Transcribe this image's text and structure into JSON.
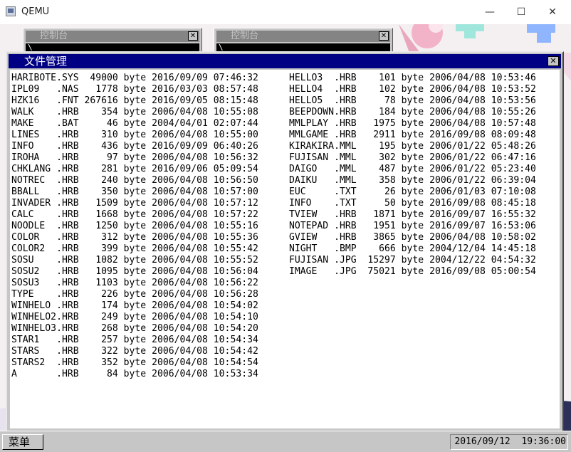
{
  "host_window": {
    "title": "QEMU",
    "minimize": "—",
    "maximize": "☐",
    "close": "✕"
  },
  "consoles": [
    {
      "title": "控制台",
      "close": "✕",
      "cursor": "\\"
    },
    {
      "title": "控制台",
      "close": "✕",
      "cursor": "\\"
    }
  ],
  "file_manager": {
    "title": "文件管理",
    "close": "✕",
    "columns": [
      [
        "HARIBOTE.SYS  49000 byte 2016/09/09 07:46:32",
        "IPL09   .NAS   1778 byte 2016/03/03 08:57:48",
        "HZK16   .FNT 267616 byte 2016/09/05 08:15:48",
        "WALK    .HRB    354 byte 2006/04/08 10:55:08",
        "MAKE    .BAT     46 byte 2004/04/01 02:07:44",
        "LINES   .HRB    310 byte 2006/04/08 10:55:00",
        "INFO    .HRB    436 byte 2016/09/09 06:40:26",
        "IROHA   .HRB     97 byte 2006/04/08 10:56:32",
        "CHKLANG .HRB    281 byte 2016/09/06 05:09:54",
        "NOTREC  .HRB    240 byte 2006/04/08 10:56:50",
        "BBALL   .HRB    350 byte 2006/04/08 10:57:00",
        "INVADER .HRB   1509 byte 2006/04/08 10:57:12",
        "CALC    .HRB   1668 byte 2006/04/08 10:57:22",
        "NOODLE  .HRB   1250 byte 2006/04/08 10:55:16",
        "COLOR   .HRB    312 byte 2006/04/08 10:55:36",
        "COLOR2  .HRB    399 byte 2006/04/08 10:55:42",
        "SOSU    .HRB   1082 byte 2006/04/08 10:55:52",
        "SOSU2   .HRB   1095 byte 2006/04/08 10:56:04",
        "SOSU3   .HRB   1103 byte 2006/04/08 10:56:22",
        "TYPE    .HRB    226 byte 2006/04/08 10:56:28",
        "WINHELO .HRB    174 byte 2006/04/08 10:54:02",
        "WINHELO2.HRB    249 byte 2006/04/08 10:54:10",
        "WINHELO3.HRB    268 byte 2006/04/08 10:54:20",
        "STAR1   .HRB    257 byte 2006/04/08 10:54:34",
        "STARS   .HRB    322 byte 2006/04/08 10:54:42",
        "STARS2  .HRB    352 byte 2006/04/08 10:54:54",
        "A       .HRB     84 byte 2006/04/08 10:53:34"
      ],
      [
        "HELLO3  .HRB    101 byte 2006/04/08 10:53:46",
        "HELLO4  .HRB    102 byte 2006/04/08 10:53:52",
        "HELLO5  .HRB     78 byte 2006/04/08 10:53:56",
        "BEEPDOWN.HRB    184 byte 2006/04/08 10:55:26",
        "MMLPLAY .HRB   1975 byte 2006/04/08 10:57:48",
        "MMLGAME .HRB   2911 byte 2016/09/08 08:09:48",
        "KIRAKIRA.MML    195 byte 2006/01/22 05:48:26",
        "FUJISAN .MML    302 byte 2006/01/22 06:47:16",
        "DAIGO   .MML    487 byte 2006/01/22 05:23:40",
        "DAIKU   .MML    358 byte 2006/01/22 06:39:04",
        "EUC     .TXT     26 byte 2006/01/03 07:10:08",
        "INFO    .TXT     50 byte 2016/09/08 08:45:18",
        "TVIEW   .HRB   1871 byte 2016/09/07 16:55:32",
        "NOTEPAD .HRB   1951 byte 2016/09/07 16:53:06",
        "GVIEW   .HRB   3865 byte 2006/04/08 10:58:02",
        "NIGHT   .BMP    666 byte 2004/12/04 14:45:18",
        "FUJISAN .JPG  15297 byte 2004/12/22 04:54:32",
        "IMAGE   .JPG  75021 byte 2016/09/08 05:00:54"
      ]
    ]
  },
  "taskbar": {
    "menu_label": "菜单",
    "clock": "2016/09/12  19:36:00"
  }
}
